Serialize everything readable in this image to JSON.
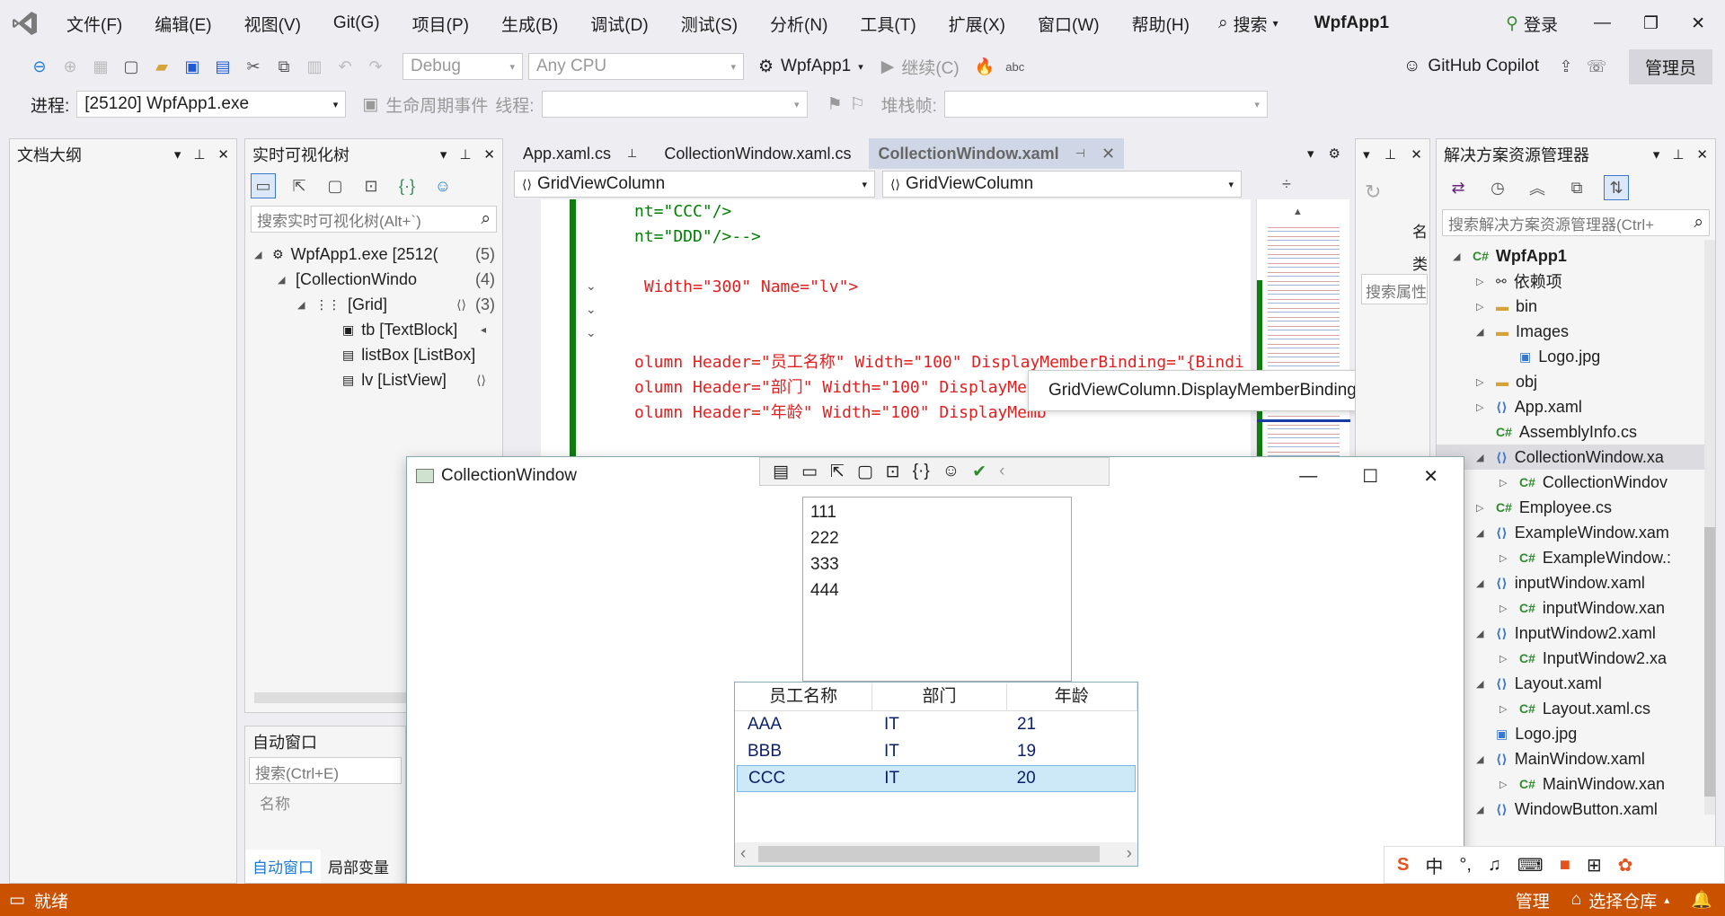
{
  "menu": {
    "items": [
      "文件(F)",
      "编辑(E)",
      "视图(V)",
      "Git(G)",
      "项目(P)",
      "生成(B)",
      "调试(D)",
      "测试(S)",
      "分析(N)",
      "工具(T)",
      "扩展(X)",
      "窗口(W)",
      "帮助(H)"
    ],
    "search_label": "搜索",
    "solution_name": "WpfApp1",
    "login_label": "登录"
  },
  "toolbar": {
    "config": "Debug",
    "platform": "Any CPU",
    "startup_project": "WpfApp1",
    "continue_label": "继续(C)",
    "copilot_label": "GitHub Copilot",
    "admin_label": "管理员"
  },
  "toolbar2": {
    "process_label": "进程:",
    "process_value": "[25120] WpfApp1.exe",
    "lifecycle_label": "生命周期事件",
    "thread_label": "线程:",
    "stackframe_label": "堆栈帧:"
  },
  "doc_outline": {
    "title": "文档大纲"
  },
  "live_tree": {
    "title": "实时可视化树",
    "search_placeholder": "搜索实时可视化树(Alt+`)",
    "rows": [
      {
        "label": "WpfApp1.exe [2512(",
        "count": "(5)"
      },
      {
        "label": "[CollectionWindo",
        "count": "(4)"
      },
      {
        "label": "[Grid]",
        "count": "(3)"
      },
      {
        "label": "tb [TextBlock]",
        "count": ""
      },
      {
        "label": "listBox [ListBox]",
        "count": ""
      },
      {
        "label": "lv [ListView]",
        "count": ""
      }
    ]
  },
  "auto_window": {
    "title": "自动窗口",
    "search_placeholder": "搜索(Ctrl+E)",
    "column_name": "名称",
    "tab_auto": "自动窗口",
    "tab_locals": "局部变量"
  },
  "editor": {
    "tabs": [
      "App.xaml.cs",
      "CollectionWindow.xaml.cs",
      "CollectionWindow.xaml"
    ],
    "nav_left": "GridViewColumn",
    "nav_right": "GridViewColumn",
    "lines": [
      {
        "text": "nt=\"CCC\"/>",
        "color": "#008000"
      },
      {
        "text": "nt=\"DDD\"/>-->",
        "color": "#008000"
      },
      {
        "text": "",
        "color": "#000000"
      },
      {
        "text": " Width=\"300\" Name=\"lv\">",
        "color": "#e21f1f"
      },
      {
        "text": "",
        "color": "#000000"
      },
      {
        "text": "",
        "color": "#000000"
      },
      {
        "text": "olumn Header=\"员工名称\" Width=\"100\" DisplayMemberBinding=\"{Bindi",
        "color": "#e21f1f"
      },
      {
        "text": "olumn Header=\"部门\" Width=\"100\" DisplayMemb",
        "color": "#e21f1f"
      },
      {
        "text": "olumn Header=\"年龄\" Width=\"100\" DisplayMemb",
        "color": "#e21f1f"
      }
    ],
    "tooltip": "GridViewColumn.DisplayMemberBinding"
  },
  "properties_panel": {
    "search_placeholder": "搜索属性"
  },
  "solution_explorer": {
    "title": "解决方案资源管理器",
    "search_placeholder": "搜索解决方案资源管理器(Ctrl+",
    "items": [
      {
        "label": "WpfApp1",
        "icon": "csproj",
        "indent": 0
      },
      {
        "label": "依赖项",
        "icon": "deps",
        "indent": 1
      },
      {
        "label": "bin",
        "icon": "folder",
        "indent": 1
      },
      {
        "label": "Images",
        "icon": "folder",
        "indent": 1
      },
      {
        "label": "Logo.jpg",
        "icon": "image",
        "indent": 2
      },
      {
        "label": "obj",
        "icon": "folder",
        "indent": 1
      },
      {
        "label": "App.xaml",
        "icon": "xaml",
        "indent": 1
      },
      {
        "label": "AssemblyInfo.cs",
        "icon": "cs",
        "indent": 1
      },
      {
        "label": "CollectionWindow.xa",
        "icon": "xaml",
        "indent": 1
      },
      {
        "label": "CollectionWindov",
        "icon": "cs",
        "indent": 2
      },
      {
        "label": "Employee.cs",
        "icon": "cs",
        "indent": 1
      },
      {
        "label": "ExampleWindow.xam",
        "icon": "xaml",
        "indent": 1
      },
      {
        "label": "ExampleWindow.:",
        "icon": "cs",
        "indent": 2
      },
      {
        "label": "inputWindow.xaml",
        "icon": "xaml",
        "indent": 1
      },
      {
        "label": "inputWindow.xan",
        "icon": "cs",
        "indent": 2
      },
      {
        "label": "InputWindow2.xaml",
        "icon": "xaml",
        "indent": 1
      },
      {
        "label": "InputWindow2.xa",
        "icon": "cs",
        "indent": 2
      },
      {
        "label": "Layout.xaml",
        "icon": "xaml",
        "indent": 1
      },
      {
        "label": "Layout.xaml.cs",
        "icon": "cs",
        "indent": 2
      },
      {
        "label": "Logo.jpg",
        "icon": "image",
        "indent": 1
      },
      {
        "label": "MainWindow.xaml",
        "icon": "xaml",
        "indent": 1
      },
      {
        "label": "MainWindow.xan",
        "icon": "cs",
        "indent": 2
      },
      {
        "label": "WindowButton.xaml",
        "icon": "xaml",
        "indent": 1
      }
    ]
  },
  "app_window": {
    "title": "CollectionWindow",
    "list_items": [
      "111",
      "222",
      "333",
      "444"
    ],
    "grid_headers": [
      "员工名称",
      "部门",
      "年龄"
    ],
    "grid_rows": [
      [
        "AAA",
        "IT",
        "21"
      ],
      [
        "BBB",
        "IT",
        "19"
      ],
      [
        "CCC",
        "IT",
        "20"
      ]
    ]
  },
  "ime": {
    "lang": "中"
  },
  "status": {
    "ready": "就绪",
    "manage": "管理",
    "repo": "选择仓库"
  },
  "colors": {
    "status_bar": "#ca5100",
    "accent": "#0066cc",
    "selected_row": "#cde8f7"
  }
}
